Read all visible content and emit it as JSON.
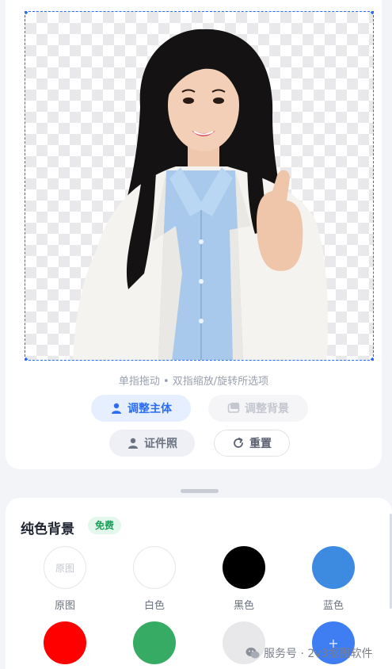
{
  "editor": {
    "hint": "单指拖动 • 双指缩放/旋转所选项",
    "buttons": {
      "adjust_subject": "调整主体",
      "adjust_background": "调整背景",
      "id_photo": "证件照",
      "reset": "重置"
    }
  },
  "solid_background": {
    "title": "纯色背景",
    "badge": "免费",
    "swatches": [
      {
        "label": "原图",
        "inner_text": "原图",
        "color": "#ffffff"
      },
      {
        "label": "白色",
        "color": "#ffffff"
      },
      {
        "label": "黑色",
        "color": "#000000"
      },
      {
        "label": "蓝色",
        "color": "#3d8be0"
      },
      {
        "color": "#ff0000"
      },
      {
        "color": "#36ab63"
      },
      {
        "color": "#e8e8ea"
      },
      {
        "color": "#3f7df2",
        "inner_text": "+"
      }
    ]
  },
  "watermark": {
    "text": "服务号 · 2v3抠图软件"
  },
  "colors": {
    "accent": "#2a6df4",
    "free_badge": "#18a058"
  }
}
